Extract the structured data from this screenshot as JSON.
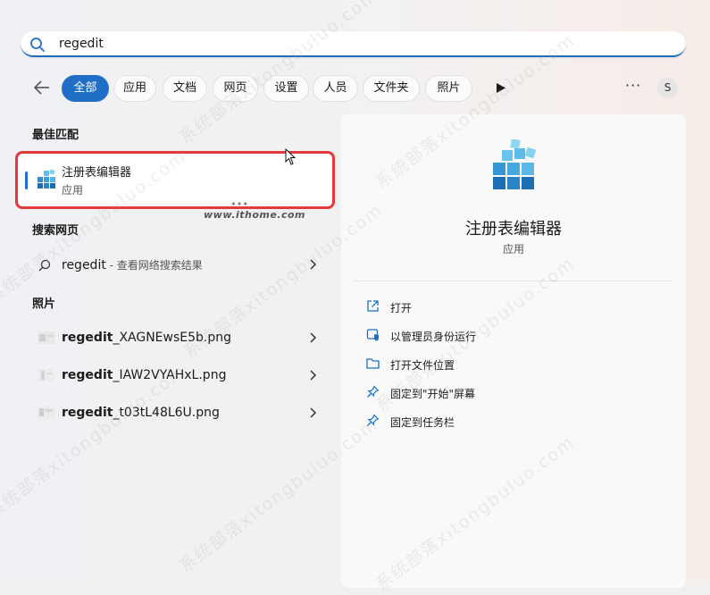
{
  "search": {
    "value": "regedit"
  },
  "filters": [
    {
      "label": "全部",
      "active": true
    },
    {
      "label": "应用",
      "active": false
    },
    {
      "label": "文档",
      "active": false
    },
    {
      "label": "网页",
      "active": false
    },
    {
      "label": "设置",
      "active": false
    },
    {
      "label": "人员",
      "active": false
    },
    {
      "label": "文件夹",
      "active": false
    },
    {
      "label": "照片",
      "active": false
    }
  ],
  "user_initial": "S",
  "sections": {
    "best_match": "最佳匹配",
    "web_search": "搜索网页",
    "photos": "照片"
  },
  "best_match": {
    "name": "注册表编辑器",
    "type": "应用"
  },
  "web_result": {
    "query": "regedit",
    "suffix": " - 查看网络搜索结果"
  },
  "photos": [
    {
      "bold": "regedit",
      "rest": "_XAGNEwsE5b.png"
    },
    {
      "bold": "regedit",
      "rest": "_IAW2VYAHxL.png"
    },
    {
      "bold": "regedit",
      "rest": "_t03tL48L6U.png"
    }
  ],
  "detail": {
    "title": "注册表编辑器",
    "type": "应用",
    "actions": [
      {
        "label": "打开",
        "icon": "open-icon"
      },
      {
        "label": "以管理员身份运行",
        "icon": "admin-shield-icon"
      },
      {
        "label": "打开文件位置",
        "icon": "folder-icon"
      },
      {
        "label": "固定到\"开始\"屏幕",
        "icon": "pin-icon"
      },
      {
        "label": "固定到任务栏",
        "icon": "pin-icon"
      }
    ]
  },
  "watermark": {
    "site": "www.ithome.com",
    "diagonal": "系统部落xitongbuluo.com"
  },
  "colors": {
    "accent": "#1f6fc6",
    "highlight": "#e43a3a"
  }
}
